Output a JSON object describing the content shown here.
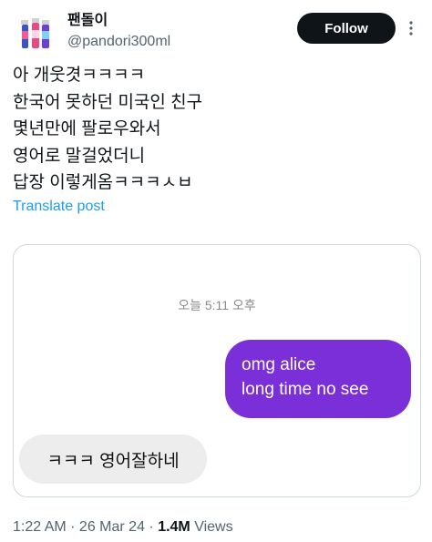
{
  "author": {
    "display_name": "팬돌이",
    "handle": "@pandori300ml"
  },
  "header": {
    "follow_label": "Follow",
    "more_icon": "more-vertical-icon"
  },
  "tweet": {
    "lines": [
      "아 개웃겻ㅋㅋㅋㅋ",
      "한국어 못하던 미국인 친구",
      "몇년만에 팔로우와서",
      "영어로 말걸었더니",
      "답장 이렇게옴ㅋㅋㅋㅅㅂ"
    ],
    "translate_label": "Translate post"
  },
  "media": {
    "timestamp": "오늘 5:11 오후",
    "sent_lines": [
      "omg alice",
      "long time no see"
    ],
    "received_text": "ㅋㅋㅋ 영어잘하네",
    "colors": {
      "sent_bubble": "#7b2fd9",
      "received_bubble": "#ededed"
    }
  },
  "meta": {
    "time": "1:22 AM",
    "sep1": " · ",
    "date": "26 Mar 24",
    "sep2": " · ",
    "views_count": "1.4M",
    "views_label": " Views"
  },
  "colors": {
    "accent": "#1d9bf0",
    "text": "#0f1419",
    "muted": "#536471"
  }
}
